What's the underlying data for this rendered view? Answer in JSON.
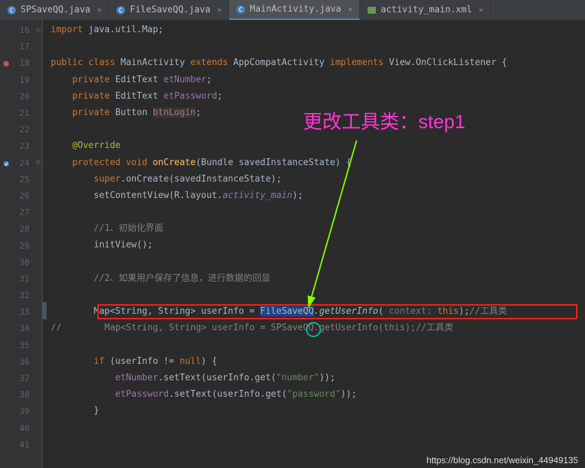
{
  "tabs": [
    {
      "icon": "java",
      "label": "SPSaveQQ.java",
      "active": false
    },
    {
      "icon": "java",
      "label": "FileSaveQQ.java",
      "active": false
    },
    {
      "icon": "java",
      "label": "MainActivity.java",
      "active": true
    },
    {
      "icon": "xml",
      "label": "activity_main.xml",
      "active": false
    }
  ],
  "line_start": 16,
  "line_end": 41,
  "code": {
    "l16": {
      "import": "import",
      "pkg": "java.util.Map;"
    },
    "l18": {
      "public": "public",
      "class": "class",
      "name": "MainActivity",
      "extends": "extends",
      "super": "AppCompatActivity",
      "implements": "implements",
      "iface": "View.OnClickListener {"
    },
    "l19": {
      "private": "private",
      "type": "EditText",
      "field": "etNumber"
    },
    "l20": {
      "private": "private",
      "type": "EditText",
      "field": "etPassword"
    },
    "l21": {
      "private": "private",
      "type": "Button",
      "field": "btnLogin"
    },
    "l23": {
      "anno": "@Override"
    },
    "l24": {
      "protected": "protected",
      "void": "void",
      "name": "onCreate",
      "params": "(Bundle savedInstanceState) {"
    },
    "l25": {
      "super": "super",
      "call": ".onCreate(savedInstanceState);"
    },
    "l26": {
      "call": "setContentView(R.layout.",
      "res": "activity_main",
      "end": ");"
    },
    "l28": {
      "comment": "//1、初始化界面"
    },
    "l29": {
      "call": "initView();"
    },
    "l31": {
      "comment": "//2、如果用户保存了信息，进行数据的回显"
    },
    "l33": {
      "decl": "Map<String, String> userInfo = ",
      "cls": "FileSaveQQ",
      "method": ".getUserInfo",
      "hint": " context: ",
      "this": "this",
      "comment": "//工具类"
    },
    "l34": {
      "slash": "//",
      "grey": "        Map<String, String> userInfo = SPSaveQQ.getUserInfo(this);//工具类"
    },
    "l36": {
      "if": "if",
      "cond": "(userInfo != ",
      "null": "null",
      "end": ") {"
    },
    "l37": {
      "field": "etNumber",
      "call": ".setText(userInfo.get(",
      "str": "\"number\"",
      "end": "));"
    },
    "l38": {
      "field": "etPassword",
      "call": ".setText(userInfo.get(",
      "str": "\"password\"",
      "end": "));"
    },
    "l39": {
      "brace": "}"
    }
  },
  "annotation": "更改工具类：step1",
  "watermark": "https://blog.csdn.net/weixin_44949135"
}
